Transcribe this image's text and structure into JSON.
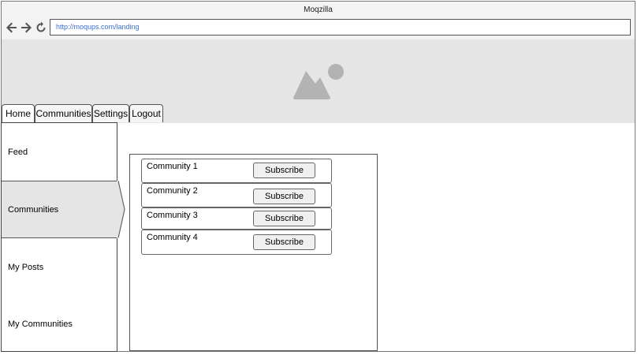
{
  "browser": {
    "title": "Moqzilla",
    "url": "http://moqups.com/landing"
  },
  "tabs": [
    {
      "label": "Home"
    },
    {
      "label": "Communities"
    },
    {
      "label": "Settings"
    },
    {
      "label": "Logout"
    }
  ],
  "sidebar": {
    "items": [
      {
        "label": "Feed"
      },
      {
        "label": "Communities"
      },
      {
        "label": "My Posts"
      },
      {
        "label": "My Communities"
      }
    ]
  },
  "communities": [
    {
      "name": "Community 1",
      "action": "Subscribe"
    },
    {
      "name": "Community 2",
      "action": "Subscribe"
    },
    {
      "name": "Community 3",
      "action": "Subscribe"
    },
    {
      "name": "Community 4",
      "action": "Subscribe"
    }
  ],
  "colors": {
    "banner": "#e5e5e5",
    "url_text": "#3b6fd0",
    "image_placeholder": "#b3b3b3"
  }
}
